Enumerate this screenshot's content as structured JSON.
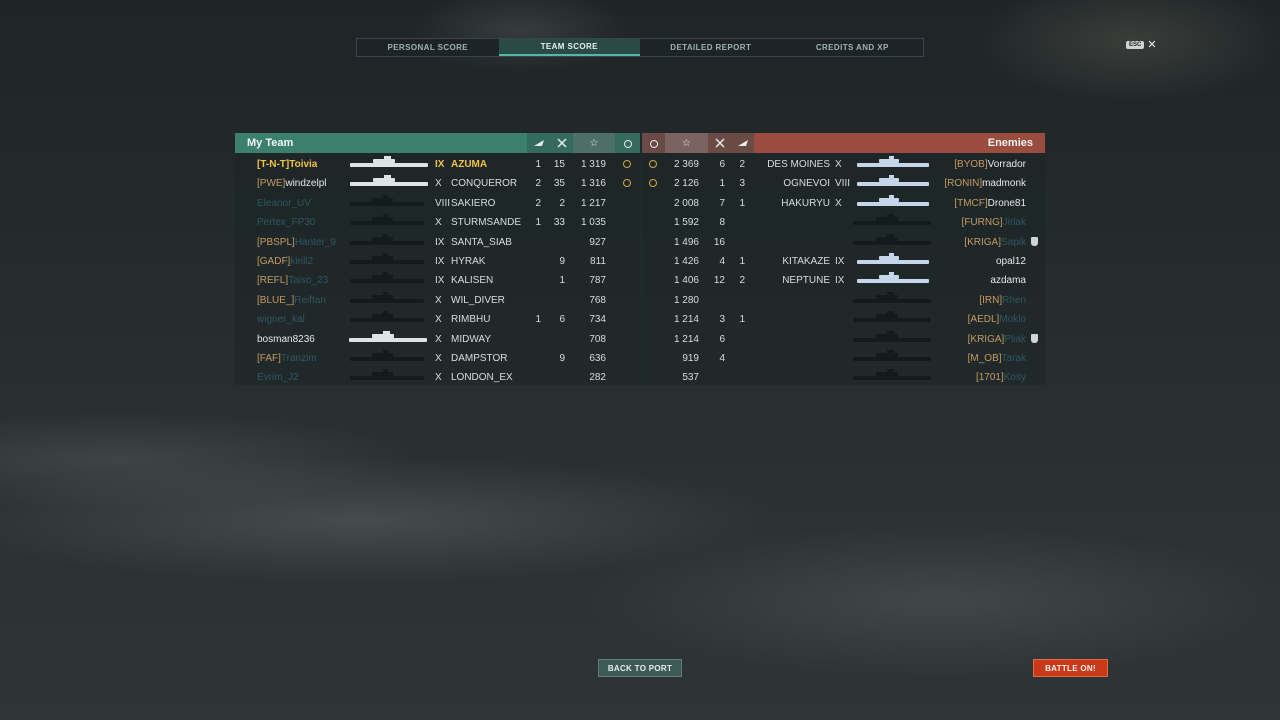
{
  "tabs": [
    {
      "label": "PERSONAL SCORE",
      "active": false
    },
    {
      "label": "TEAM SCORE",
      "active": true
    },
    {
      "label": "DETAILED REPORT",
      "active": false
    },
    {
      "label": "CREDITS AND XP",
      "active": false
    }
  ],
  "esc_key": "ESC",
  "close_glyph": "✕",
  "headers": {
    "my_team": "My Team",
    "enemies": "Enemies",
    "star_icon": "☆"
  },
  "my_team": [
    {
      "clan": "[T-N-T]",
      "name": "Toivia",
      "tier": "IX",
      "ship": "AZUMA",
      "planes": "1",
      "kills": "15",
      "score": "1 319",
      "me": true,
      "alive": true,
      "smile": true
    },
    {
      "clan": "[PWE]",
      "name": "windzelpl",
      "tier": "X",
      "ship": "CONQUEROR",
      "planes": "2",
      "kills": "35",
      "score": "1 316",
      "alive": true,
      "smile": true
    },
    {
      "clan": "",
      "name": "Eleanor_UV",
      "tier": "VIII",
      "ship": "SAKIERO",
      "planes": "2",
      "kills": "2",
      "score": "1 217",
      "alive": false
    },
    {
      "clan": "",
      "name": "Pertex_FP30",
      "tier": "X",
      "ship": "STURMSANDE",
      "planes": "1",
      "kills": "33",
      "score": "1 035",
      "alive": false
    },
    {
      "clan": "[PBSPL]",
      "name": "Hanter_9",
      "tier": "IX",
      "ship": "SANTA_SIAB",
      "planes": "",
      "kills": "",
      "score": "927",
      "alive": false
    },
    {
      "clan": "[GADF]",
      "name": "kirill2",
      "tier": "IX",
      "ship": "HYRAK",
      "planes": "",
      "kills": "9",
      "score": "811",
      "alive": false
    },
    {
      "clan": "[REFL]",
      "name": "Taiso_23",
      "tier": "IX",
      "ship": "KALISEN",
      "planes": "",
      "kills": "1",
      "score": "787",
      "alive": false
    },
    {
      "clan": "[BLUE_]",
      "name": "Reiftan",
      "tier": "X",
      "ship": "WIL_DIVER",
      "planes": "",
      "kills": "",
      "score": "768",
      "alive": false
    },
    {
      "clan": "",
      "name": "wigner_kal",
      "tier": "X",
      "ship": "RIMBHU",
      "planes": "1",
      "kills": "6",
      "score": "734",
      "alive": false
    },
    {
      "clan": "",
      "name": "bosman8236",
      "tier": "X",
      "ship": "MIDWAY",
      "planes": "",
      "kills": "",
      "score": "708",
      "alive": true
    },
    {
      "clan": "[FAF]",
      "name": "Tranzim",
      "tier": "X",
      "ship": "DAMPSTOR",
      "planes": "",
      "kills": "9",
      "score": "636",
      "alive": false
    },
    {
      "clan": "",
      "name": "Evrim_J2",
      "tier": "X",
      "ship": "LONDON_EX",
      "planes": "",
      "kills": "",
      "score": "282",
      "alive": false
    }
  ],
  "enemies": [
    {
      "score": "2 369",
      "kills": "6",
      "planes": "2",
      "ship": "DES MOINES",
      "tier": "X",
      "clan": "[BYOB]",
      "name": "Vorrador",
      "alive": true,
      "smile": true
    },
    {
      "score": "2 126",
      "kills": "1",
      "planes": "3",
      "ship": "OGNEVOI",
      "tier": "VIII",
      "clan": "[RONIN]",
      "name": "madmonk",
      "alive": true,
      "smile": true
    },
    {
      "score": "2 008",
      "kills": "7",
      "planes": "1",
      "ship": "HAKURYU",
      "tier": "X",
      "clan": "[TMCF]",
      "name": "Drone81",
      "alive": true
    },
    {
      "score": "1 592",
      "kills": "8",
      "planes": "",
      "ship": "",
      "tier": "",
      "clan": "[FURNG]",
      "name": "Jirlak",
      "alive": false
    },
    {
      "score": "1 496",
      "kills": "16",
      "planes": "",
      "ship": "",
      "tier": "",
      "clan": "[KRIGA]",
      "name": "Sapik",
      "alive": false,
      "badge": true
    },
    {
      "score": "1 426",
      "kills": "4",
      "planes": "1",
      "ship": "KITAKAZE",
      "tier": "IX",
      "clan": "",
      "name": "opal12",
      "alive": true
    },
    {
      "score": "1 406",
      "kills": "12",
      "planes": "2",
      "ship": "NEPTUNE",
      "tier": "IX",
      "clan": "",
      "name": "azdama",
      "alive": true
    },
    {
      "score": "1 280",
      "kills": "",
      "planes": "",
      "ship": "",
      "tier": "",
      "clan": "[IRN]",
      "name": "Rhen",
      "alive": false
    },
    {
      "score": "1 214",
      "kills": "3",
      "planes": "1",
      "ship": "",
      "tier": "",
      "clan": "[AEDL]",
      "name": "Moklo",
      "alive": false
    },
    {
      "score": "1 214",
      "kills": "6",
      "planes": "",
      "ship": "",
      "tier": "",
      "clan": "[KRIGA]",
      "name": "Pliak",
      "alive": false,
      "badge": true
    },
    {
      "score": "919",
      "kills": "4",
      "planes": "",
      "ship": "",
      "tier": "",
      "clan": "[M_OB]",
      "name": "Tarak",
      "alive": false
    },
    {
      "score": "537",
      "kills": "",
      "planes": "",
      "ship": "",
      "tier": "",
      "clan": "[1701]",
      "name": "Kosy",
      "alive": false
    }
  ],
  "buttons": {
    "back_to_port": "BACK TO PORT",
    "battle_on": "BATTLE ON!"
  },
  "colors": {
    "my_team": "#3b7f6d",
    "enemies": "#9a4c3e",
    "player_highlight": "#f2c24a",
    "battle_button": "#c8391a"
  }
}
